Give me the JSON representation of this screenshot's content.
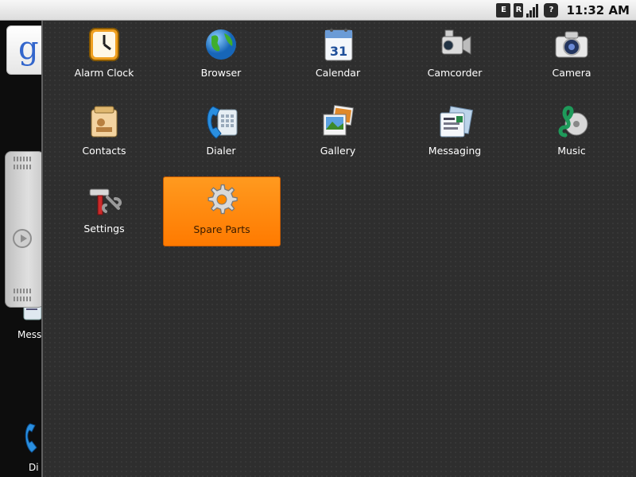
{
  "status_bar": {
    "network_badge": "E",
    "roaming_badge": "R",
    "unknown_badge": "?",
    "time": "11:32 AM"
  },
  "home_screen": {
    "google_letter": "g",
    "partial_labels": {
      "messaging": "Mess",
      "dialer": "Di"
    }
  },
  "apps": [
    {
      "label": "Alarm Clock",
      "icon": "alarm-clock-icon"
    },
    {
      "label": "Browser",
      "icon": "globe-icon"
    },
    {
      "label": "Calendar",
      "icon": "calendar-icon",
      "icon_text": "31"
    },
    {
      "label": "Camcorder",
      "icon": "camcorder-icon"
    },
    {
      "label": "Camera",
      "icon": "camera-icon"
    },
    {
      "label": "Contacts",
      "icon": "contacts-icon"
    },
    {
      "label": "Dialer",
      "icon": "phone-icon"
    },
    {
      "label": "Gallery",
      "icon": "gallery-icon"
    },
    {
      "label": "Messaging",
      "icon": "messaging-icon"
    },
    {
      "label": "Music",
      "icon": "music-icon"
    },
    {
      "label": "Settings",
      "icon": "settings-tools-icon"
    },
    {
      "label": "Spare Parts",
      "icon": "gear-icon",
      "selected": true
    }
  ],
  "colors": {
    "selection": "#ff8a00",
    "drawer_bg": "#2e2e2e",
    "status_bar_bg": "#e6e6e6"
  }
}
